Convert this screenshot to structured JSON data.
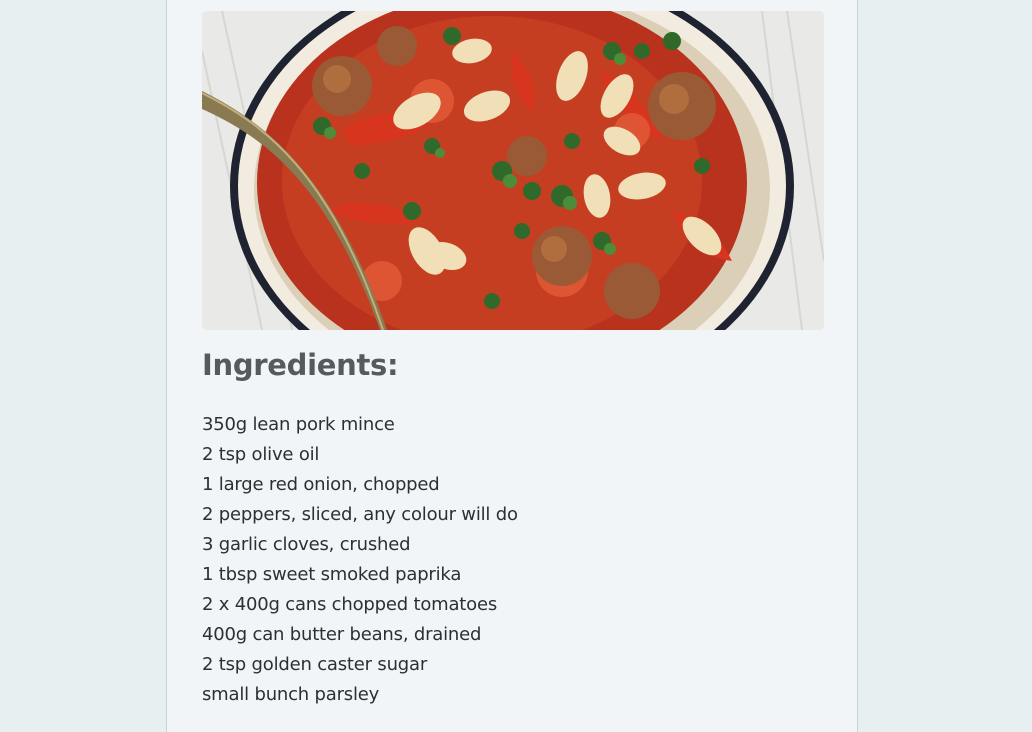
{
  "recipe": {
    "heading": "Ingredients:",
    "ingredients": [
      "350g lean pork mince",
      "2 tsp olive oil",
      "1 large red onion, chopped",
      "2 peppers, sliced, any colour will do",
      "3 garlic cloves, crushed",
      "1 tbsp sweet smoked paprika",
      "2 x 400g cans chopped tomatoes",
      "400g can butter beans, drained",
      "2 tsp golden caster sugar",
      "small bunch parsley"
    ]
  },
  "colors": {
    "page_background": "#e8eff1",
    "card_background": "#f1f5f7",
    "heading": "#555a5d",
    "text": "#2d3033"
  }
}
